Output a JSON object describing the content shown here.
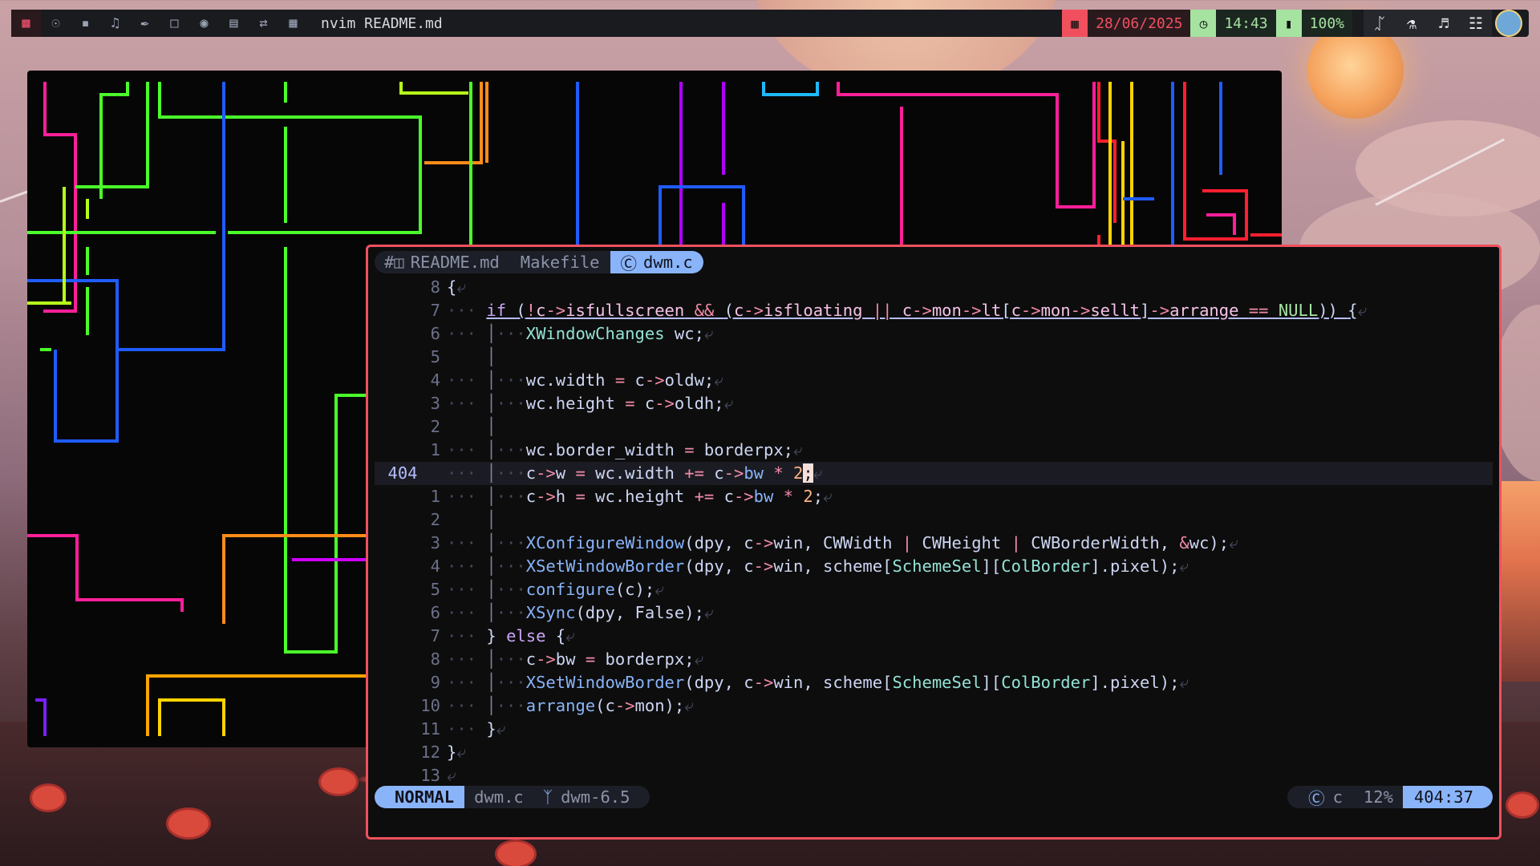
{
  "topbar": {
    "icons": [
      "terminal-icon",
      "globe-icon",
      "chat-icon",
      "music-icon",
      "brush-icon",
      "folder-icon",
      "gamepad-icon",
      "notes-icon",
      "shuffle-icon",
      "grid-icon"
    ],
    "title": "nvim README.md",
    "date": "28/06/2025",
    "time": "14:43",
    "battery": "100%",
    "date_color": "#f0505e",
    "time_color": "#a6e3a1"
  },
  "editor": {
    "tabs": [
      {
        "label": "README.md",
        "icon": "markdown-icon"
      },
      {
        "label": "Makefile"
      },
      {
        "label": "dwm.c",
        "icon": "c-icon",
        "active": true
      }
    ],
    "lines": [
      {
        "n": "8",
        "html": "<span class='id'>{</span><span class='g'>⤶</span>"
      },
      {
        "n": "7",
        "html": "<span class='g'>···</span> <span class='und'><span class='kw'>if</span> <span class='id'>(</span><span class='op'>!</span><span class='mem'>c</span><span class='op'>-></span><span class='mem'>isfullscreen</span> <span class='op'>&&</span> <span class='id'>(</span><span class='mem'>c</span><span class='op'>-></span><span class='mem'>isfloating</span> <span class='op'>||</span> <span class='mem'>c</span><span class='op'>-></span><span class='mem'>mon</span><span class='op'>-></span><span class='mem'>lt</span><span class='id'>[</span><span class='mem'>c</span><span class='op'>-></span><span class='mem'>mon</span><span class='op'>-></span><span class='mem'>sellt</span><span class='id'>]</span><span class='op'>-></span><span class='mem'>arrange</span> <span class='op'>==</span> <span class='cst'>NULL</span><span class='id'>))</span> <span class='id'>{</span></span><span class='g'>⤶</span>"
      },
      {
        "n": "6",
        "html": "<span class='g'>···</span> <span class='bar'>│</span><span class='g'>···</span><span class='ty2'>XWindowChanges</span> <span class='id'>wc;</span><span class='g'>⤶</span>"
      },
      {
        "n": "5",
        "html": "<span class='g'>   </span> <span class='bar'>│</span>"
      },
      {
        "n": "4",
        "html": "<span class='g'>···</span> <span class='bar'>│</span><span class='g'>···</span><span class='id'>wc.width</span> <span class='op'>=</span> <span class='id'>c</span><span class='op'>-></span><span class='id'>oldw;</span><span class='g'>⤶</span>"
      },
      {
        "n": "3",
        "html": "<span class='g'>···</span> <span class='bar'>│</span><span class='g'>···</span><span class='id'>wc.height</span> <span class='op'>=</span> <span class='id'>c</span><span class='op'>-></span><span class='id'>oldh;</span><span class='g'>⤶</span>"
      },
      {
        "n": "2",
        "html": "<span class='g'>   </span> <span class='bar'>│</span>"
      },
      {
        "n": "1",
        "html": "<span class='g'>···</span> <span class='bar'>│</span><span class='g'>···</span><span class='id'>wc.border_width</span> <span class='op'>=</span> <span class='id'>borderpx;</span><span class='g'>⤶</span>"
      },
      {
        "n": "404",
        "cur": true,
        "html": "<span class='g'>···</span> <span class='bar'>│</span><span class='g'>···</span><span class='id'>c</span><span class='op'>-></span><span class='id'>w</span> <span class='op'>=</span> <span class='id'>wc.width</span> <span class='op'>+=</span> <span class='id'>c</span><span class='op'>-></span><span class='fn'>bw</span> <span class='op'>*</span> <span class='num'>2</span><span class='cursor'>;</span><span class='g'>⤶</span>"
      },
      {
        "n": "1",
        "html": "<span class='g'>···</span> <span class='bar'>│</span><span class='g'>···</span><span class='id'>c</span><span class='op'>-></span><span class='id'>h</span> <span class='op'>=</span> <span class='id'>wc.height</span> <span class='op'>+=</span> <span class='id'>c</span><span class='op'>-></span><span class='fn'>bw</span> <span class='op'>*</span> <span class='num'>2</span><span class='id'>;</span><span class='g'>⤶</span>"
      },
      {
        "n": "2",
        "html": "<span class='g'>   </span> <span class='bar'>│</span>"
      },
      {
        "n": "3",
        "html": "<span class='g'>···</span> <span class='bar'>│</span><span class='g'>···</span><span class='fn'>XConfigureWindow</span><span class='id'>(dpy,</span> <span class='id'>c</span><span class='op'>-></span><span class='id'>win,</span> <span class='id'>CWWidth</span> <span class='op'>|</span> <span class='id'>CWHeight</span> <span class='op'>|</span> <span class='id'>CWBorderWidth,</span> <span class='op'>&</span><span class='id'>wc);</span><span class='g'>⤶</span>"
      },
      {
        "n": "4",
        "html": "<span class='g'>···</span> <span class='bar'>│</span><span class='g'>···</span><span class='fn'>XSetWindowBorder</span><span class='id'>(dpy,</span> <span class='id'>c</span><span class='op'>-></span><span class='id'>win,</span> <span class='id'>scheme[</span><span class='ty2'>SchemeSel</span><span class='id'>][</span><span class='ty2'>ColBorder</span><span class='id'>].pixel);</span><span class='g'>⤶</span>"
      },
      {
        "n": "5",
        "html": "<span class='g'>···</span> <span class='bar'>│</span><span class='g'>···</span><span class='fn'>configure</span><span class='id'>(c);</span><span class='g'>⤶</span>"
      },
      {
        "n": "6",
        "html": "<span class='g'>···</span> <span class='bar'>│</span><span class='g'>···</span><span class='fn'>XSync</span><span class='id'>(dpy,</span> <span class='id'>False);</span><span class='g'>⤶</span>"
      },
      {
        "n": "7",
        "html": "<span class='g'>···</span> <span class='id'>}</span> <span class='kw'>else</span> <span class='id'>{</span><span class='g'>⤶</span>"
      },
      {
        "n": "8",
        "html": "<span class='g'>···</span> <span class='bar'>│</span><span class='g'>···</span><span class='id'>c</span><span class='op'>-></span><span class='id'>bw</span> <span class='op'>=</span> <span class='id'>borderpx;</span><span class='g'>⤶</span>"
      },
      {
        "n": "9",
        "html": "<span class='g'>···</span> <span class='bar'>│</span><span class='g'>···</span><span class='fn'>XSetWindowBorder</span><span class='id'>(dpy,</span> <span class='id'>c</span><span class='op'>-></span><span class='id'>win,</span> <span class='id'>scheme[</span><span class='ty2'>SchemeSel</span><span class='id'>][</span><span class='ty2'>ColBorder</span><span class='id'>].pixel);</span><span class='g'>⤶</span>"
      },
      {
        "n": "10",
        "html": "<span class='g'>···</span> <span class='bar'>│</span><span class='g'>···</span><span class='fn'>arrange</span><span class='id'>(c</span><span class='op'>-></span><span class='id'>mon);</span><span class='g'>⤶</span>"
      },
      {
        "n": "11",
        "html": "<span class='g'>···</span> <span class='id'>}</span><span class='g'>⤶</span>"
      },
      {
        "n": "12",
        "html": "<span class='id'>}</span><span class='g'>⤶</span>"
      },
      {
        "n": "13",
        "html": "<span class='g'>⤶</span>"
      }
    ],
    "status": {
      "mode": "NORMAL",
      "file": "dwm.c",
      "branch": "dwm-6.5",
      "filetype": "c",
      "percent": "12%",
      "position": "404:37",
      "accent": "#89b4fa"
    }
  }
}
